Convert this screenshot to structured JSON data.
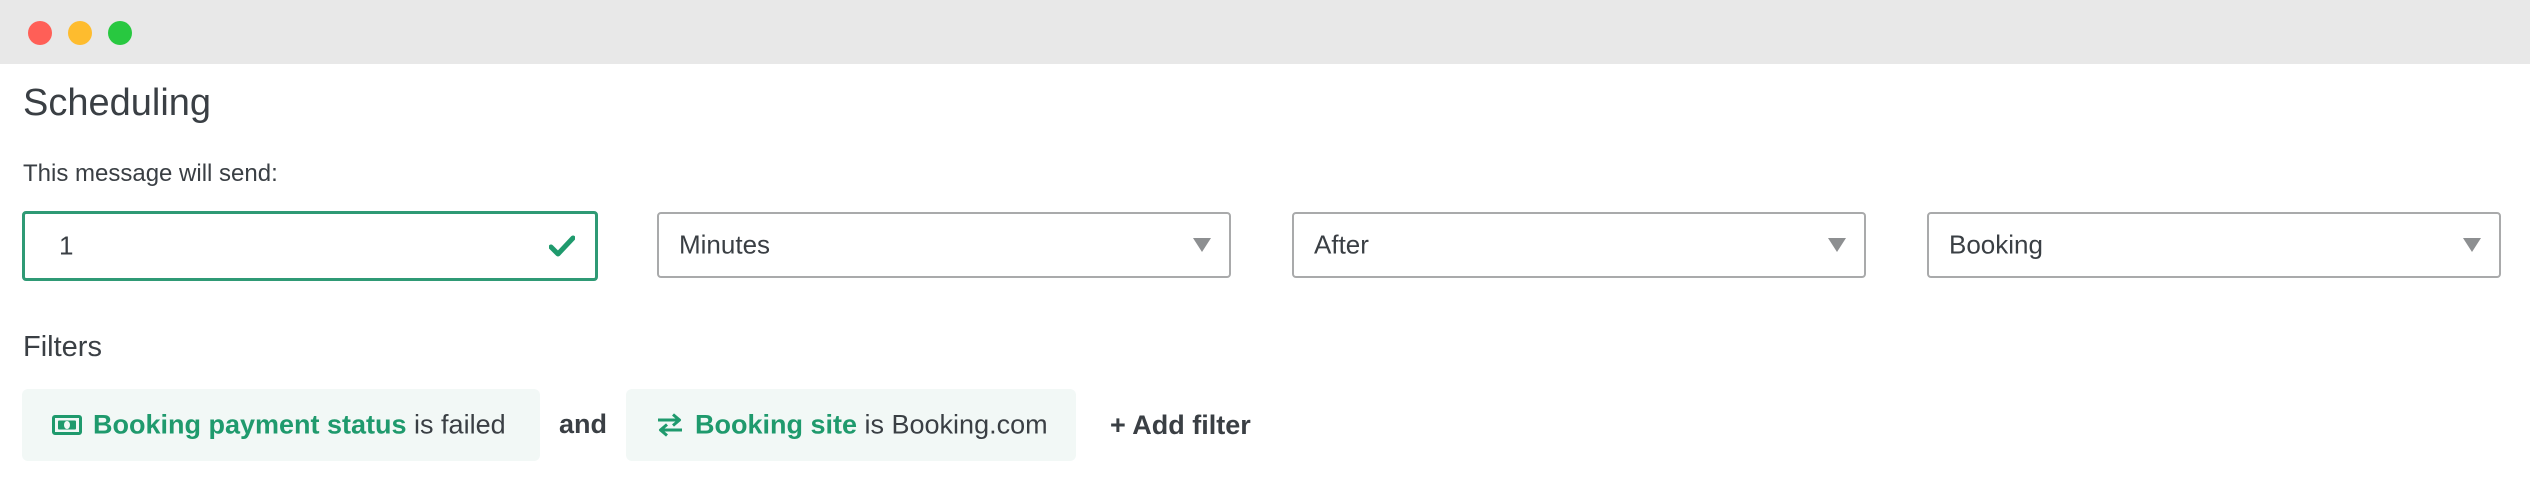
{
  "window": {
    "controls": [
      "close",
      "minimize",
      "maximize"
    ]
  },
  "scheduling": {
    "title": "Scheduling",
    "subtitle": "This message will send:",
    "amount": {
      "value": "1",
      "valid": true
    },
    "unit": {
      "selected": "Minutes"
    },
    "relation": {
      "selected": "After"
    },
    "event": {
      "selected": "Booking"
    }
  },
  "filters": {
    "label": "Filters",
    "conjunction": "and",
    "items": [
      {
        "icon": "money-icon",
        "field": "Booking payment status",
        "rest": " is failed"
      },
      {
        "icon": "swap-arrows-icon",
        "field": "Booking site",
        "rest": " is Booking.com"
      }
    ],
    "add_label": "+ Add filter"
  },
  "colors": {
    "accent": "#1f9a6d",
    "valid_border": "#2f9a75",
    "chip_bg": "#f2f8f6",
    "titlebar": "#e8e8e8"
  }
}
